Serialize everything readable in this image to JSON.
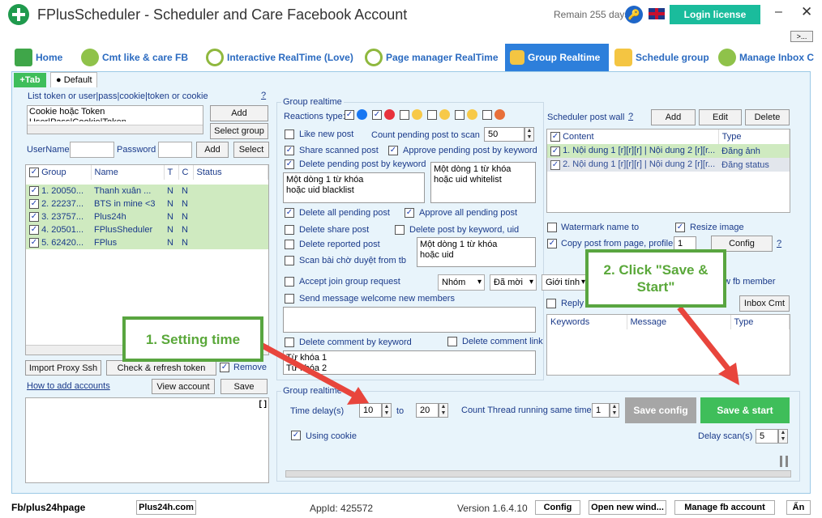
{
  "window": {
    "title": "FPlusScheduler - Scheduler and Care Facebook Account",
    "remain": "Remain 255 days",
    "login_label": "Login license",
    "min": "–",
    "close": "✕",
    "more": ">..."
  },
  "tabs": [
    "Home",
    "Cmt like & care FB",
    "Interactive RealTime (Love)",
    "Page manager RealTime",
    "Group Realtime",
    "Schedule group",
    "Manage Inbox C"
  ],
  "subtabs": {
    "add": "+Tab",
    "default": "Default"
  },
  "left": {
    "token_label": "List token or user|pass|cookie|token or cookie",
    "token_value": "Cookie hoặc Token",
    "token_value2": "User|Pass|Cookie|Token",
    "help": "?",
    "add": "Add",
    "select_group": "Select group",
    "username_label": "UserName",
    "password_label": "Password",
    "add2": "Add",
    "select": "Select",
    "columns": [
      "Group",
      "Name",
      "T",
      "C",
      "Status"
    ],
    "rows": [
      {
        "group": "1. 20050...",
        "name": "Thanh xuân ...",
        "t": "N",
        "c": "N"
      },
      {
        "group": "2. 22237...",
        "name": "BTS in mine <3",
        "t": "N",
        "c": "N"
      },
      {
        "group": "3. 23757...",
        "name": "Plus24h",
        "t": "N",
        "c": "N"
      },
      {
        "group": "4. 20501...",
        "name": "FPlusSheduler",
        "t": "N",
        "c": "N"
      },
      {
        "group": "5. 62420...",
        "name": "FPlus",
        "t": "N",
        "c": "N"
      }
    ],
    "import_proxy": "Import Proxy Ssh",
    "check_refresh": "Check & refresh token",
    "remove": "Remove",
    "how_to": "How to add accounts",
    "view_account": "View account",
    "save": "Save",
    "log_btn": "[ ]"
  },
  "mid": {
    "section": "Group realtime",
    "reactions_label": "Reactions type:",
    "like_new_post": "Like new post",
    "count_pending_label": "Count pending post to scan",
    "count_pending": "50",
    "share_scanned": "Share scanned post",
    "approve_pending_kw": "Approve pending post by keyword",
    "delete_pending_kw": "Delete pending post by keyword",
    "blacklist": "Một dòng 1 từ khóa\nhoặc uid blacklist",
    "whitelist": "Một dòng 1 từ khóa\nhoặc uid whitelist",
    "delete_all_pending": "Delete all pending post",
    "approve_all_pending": "Approve all pending post",
    "delete_share": "Delete share post",
    "delete_post_kw_uid": "Delete post by keyword, uid",
    "delete_reported": "Delete reported post",
    "scan_pending": "Scan bài chờ duyệt from tb",
    "kw_uid": "Một dòng 1 từ khóa\nhoặc uid",
    "accept_join": "Accept join group request",
    "dd1": "Nhóm",
    "dd2": "Đã mời",
    "dd3": "Giới tính",
    "send_welcome": "Send message welcome new members",
    "delete_comment_kw": "Delete comment by keyword",
    "delete_comment_link": "Delete comment link",
    "comment_kw": "Từ khóa 1\nTừ khóa 2"
  },
  "right": {
    "sched_label": "Scheduler post wall",
    "help": "?",
    "add": "Add",
    "edit": "Edit",
    "delete": "Delete",
    "columns": [
      "Content",
      "Type"
    ],
    "rows": [
      {
        "content": "1. Nội dung 1 [r][r][r] | Nội dung 2  [r][r...",
        "type": "Đăng ảnh"
      },
      {
        "content": "2. Nội dung 1 [r][r][r] | Nội dung 2  [r][r...",
        "type": "Đăng status"
      }
    ],
    "watermark": "Watermark name to",
    "resize": "Resize image",
    "copy_post": "Copy post from page, profile",
    "copy_num": "1",
    "config": "Config",
    "new_fb_member": "w fb member",
    "reply": "Reply",
    "inbox_cmt": "Inbox Cmt",
    "kw_columns": [
      "Keywords",
      "Message",
      "Type"
    ]
  },
  "bottom": {
    "section": "Group realtime",
    "time_delay_label": "Time delay(s)",
    "from": "10",
    "to_label": "to",
    "to": "20",
    "thread_label": "Count Thread running same time",
    "thread": "1",
    "save_config": "Save config",
    "save_start": "Save & start",
    "using_cookie": "Using cookie",
    "delay_scan_label": "Delay scan(s)",
    "delay_scan": "5"
  },
  "callouts": {
    "one": "1. Setting time",
    "two": "2. Click \"Save &\nStart\""
  },
  "status": {
    "fb": "Fb/plus24hpage",
    "site": "Plus24h.com",
    "appid": "AppId: 425572",
    "version": "Version 1.6.4.10",
    "config": "Config",
    "open_new": "Open new wind...",
    "manage_fb": "Manage fb account",
    "hide": "Ẩn"
  },
  "colors": {
    "accent": "#2d7fdb",
    "green": "#3fbe5a",
    "callout": "#59a540",
    "arrow": "#e8453c"
  }
}
